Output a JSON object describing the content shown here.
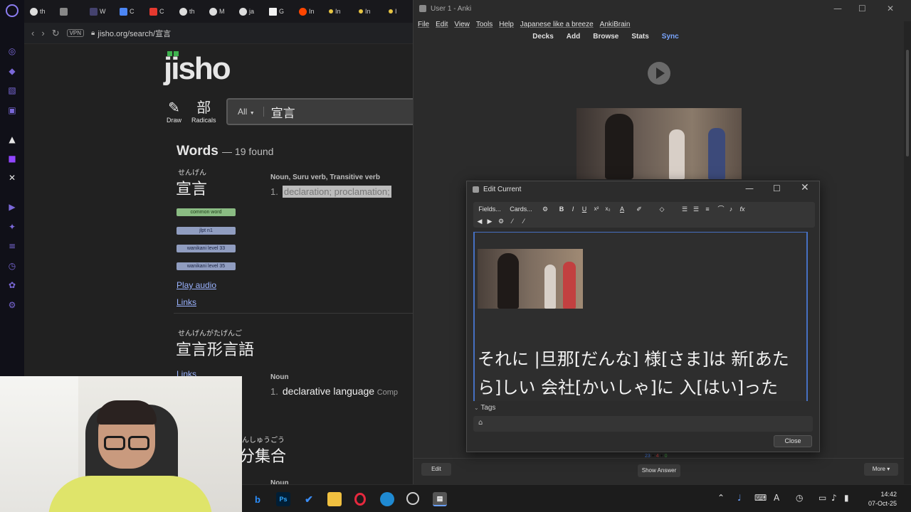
{
  "browser": {
    "tabs": [
      {
        "label": "th",
        "icon": "google-icon"
      },
      {
        "label": "",
        "icon": "youtube-icon"
      },
      {
        "label": "W",
        "icon": "hi-icon"
      },
      {
        "label": "C",
        "icon": "docs-icon"
      },
      {
        "label": "C",
        "icon": "tk-icon"
      },
      {
        "label": "th",
        "icon": "google-icon"
      },
      {
        "label": "M",
        "icon": "google-icon"
      },
      {
        "label": "ja",
        "icon": "google-icon"
      },
      {
        "label": "G",
        "icon": "doc-icon"
      },
      {
        "label": "In",
        "icon": "reddit-icon"
      },
      {
        "label": "In",
        "icon": "dot-icon"
      },
      {
        "label": "In",
        "icon": "dot-icon"
      },
      {
        "label": "I",
        "icon": "dot-icon"
      }
    ],
    "vpn": "VPN",
    "url": "jisho.org/search/宣言"
  },
  "jisho": {
    "logo": "jisho",
    "draw_label": "Draw",
    "radicals_label": "Radicals",
    "radicals_glyph": "部",
    "search_filter": "All",
    "search_value": "宣言",
    "words_heading": "Words",
    "words_count": "— 19 found",
    "entry1": {
      "furigana": "せんげん",
      "word": "宣言",
      "pos": "Noun, Suru verb, Transitive verb",
      "num": "1.",
      "meaning": "declaration; proclamation;",
      "badges": [
        "common word",
        "jlpt n1",
        "wanikani level 33",
        "wanikani level 35"
      ],
      "play_audio": "Play audio",
      "links": "Links"
    },
    "entry2": {
      "furigana": "せんげんがたげんご",
      "word": "宣言形言語",
      "links": "Links",
      "pos": "Noun",
      "num": "1.",
      "meaning": "declarative language",
      "extra": "Comp"
    },
    "entry3": {
      "furigana": "んしゅうごう",
      "word": "分集合",
      "pos": "Noun"
    }
  },
  "anki": {
    "title": "User 1 - Anki",
    "menu": [
      "File",
      "Edit",
      "View",
      "Tools",
      "Help",
      "Japanese like a breeze",
      "AnkiBrain"
    ],
    "toolbar": [
      "Decks",
      "Add",
      "Browse",
      "Stats"
    ],
    "sync": "Sync",
    "due_counts": [
      "23",
      "4",
      "0"
    ],
    "edit_button": "Edit",
    "show_answer": "Show Answer",
    "more_button": "More ▾"
  },
  "edit_dialog": {
    "title": "Edit Current",
    "fields_btn": "Fields...",
    "cards_btn": "Cards...",
    "field_text": "それに |旦那[だんな] 様[さま]は 新[あたら]しい 会社[かいしゃ]に 入[はい]った",
    "tags_label": "Tags",
    "close": "Close"
  },
  "taskbar": {
    "time": "14:42",
    "date": "07-Oct-25"
  },
  "colors": {
    "jisho_green": "#3fb34f",
    "common_badge": "#8abc83",
    "jlpt_badge": "#909dc0",
    "anki_sync": "#7aa6ff",
    "field_border": "#4670c2"
  }
}
